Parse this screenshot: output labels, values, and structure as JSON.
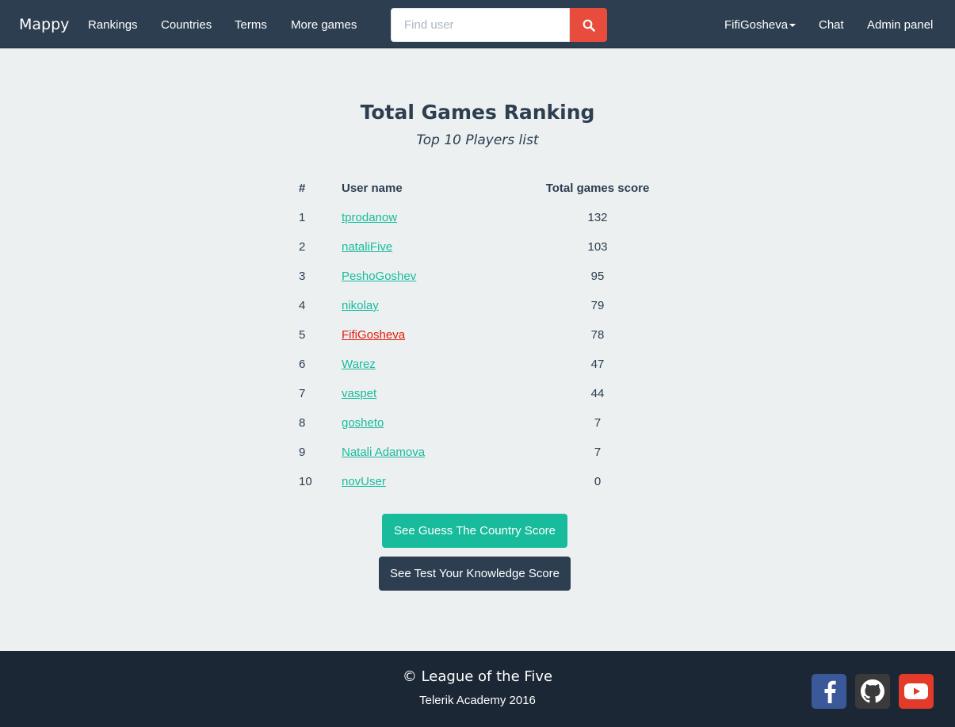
{
  "navbar": {
    "brand": "Mappy",
    "links": [
      "Rankings",
      "Countries",
      "Terms",
      "More games"
    ],
    "search_placeholder": "Find user",
    "user_menu": "FifiGosheva",
    "chat": "Chat",
    "admin": "Admin panel"
  },
  "page": {
    "title": "Total Games Ranking",
    "subtitle": "Top 10 Players list"
  },
  "table": {
    "headers": [
      "#",
      "User name",
      "Total games score"
    ],
    "rows": [
      {
        "rank": "1",
        "user": "tprodanow",
        "score": "132"
      },
      {
        "rank": "2",
        "user": "nataliFive",
        "score": "103"
      },
      {
        "rank": "3",
        "user": "PeshoGoshev",
        "score": "95"
      },
      {
        "rank": "4",
        "user": "nikolay",
        "score": "79"
      },
      {
        "rank": "5",
        "user": "FifiGosheva",
        "score": "78"
      },
      {
        "rank": "6",
        "user": "Warez",
        "score": "47"
      },
      {
        "rank": "7",
        "user": "vaspet",
        "score": "44"
      },
      {
        "rank": "8",
        "user": "gosheto",
        "score": "7"
      },
      {
        "rank": "9",
        "user": "Natali Adamova",
        "score": "7"
      },
      {
        "rank": "10",
        "user": "novUser",
        "score": "0"
      }
    ]
  },
  "buttons": {
    "guess_country": "See Guess The Country Score",
    "test_knowledge": "See Test Your Knowledge Score"
  },
  "footer": {
    "title": "© League of the Five",
    "subtitle": "Telerik Academy 2016",
    "social": [
      "facebook-icon",
      "github-icon",
      "youtube-icon"
    ]
  },
  "colors": {
    "navbar": "#2c3e50",
    "accent": "#18bc9c",
    "danger": "#e74c3c",
    "current_user": "#e31b0b",
    "footer": "#1b2735"
  }
}
